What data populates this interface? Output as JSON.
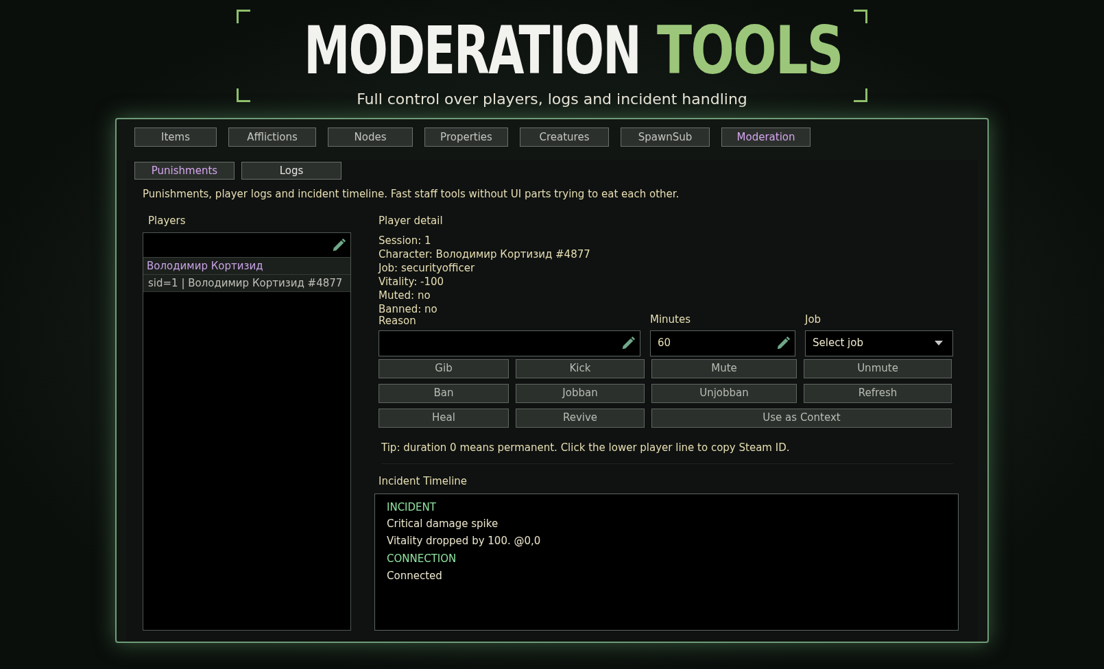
{
  "header": {
    "title_main": "MODERATION",
    "title_accent": "TOOLS",
    "subtitle": "Full control over players, logs and incident handling"
  },
  "tabs": [
    {
      "label": "Items",
      "selected": false
    },
    {
      "label": "Afflictions",
      "selected": false
    },
    {
      "label": "Nodes",
      "selected": false
    },
    {
      "label": "Properties",
      "selected": false
    },
    {
      "label": "Creatures",
      "selected": false
    },
    {
      "label": "SpawnSub",
      "selected": false
    },
    {
      "label": "Moderation",
      "selected": true
    }
  ],
  "subtabs": [
    {
      "label": "Punishments",
      "selected": true
    },
    {
      "label": "Logs",
      "selected": false
    }
  ],
  "description": "Punishments, player logs and incident timeline. Fast staff tools without UI parts trying to eat each other.",
  "players": {
    "label": "Players",
    "entries": [
      {
        "name": "Володимир Кортизид",
        "detail": "sid=1 | Володимир Кортизид #4877"
      }
    ]
  },
  "player_detail": {
    "label": "Player detail",
    "lines": [
      "Session: 1",
      "Character: Володимир Кортизид #4877",
      "Job: securityofficer",
      "Vitality: -100",
      "Muted: no",
      "Banned: no"
    ],
    "reason": {
      "label": "Reason"
    },
    "minutes": {
      "label": "Minutes",
      "value": "60"
    },
    "job": {
      "label": "Job",
      "value": "Select job"
    }
  },
  "actions": [
    {
      "label": "Gib",
      "kind": "normal"
    },
    {
      "label": "Kick",
      "kind": "normal"
    },
    {
      "label": "Mute",
      "kind": "normal"
    },
    {
      "label": "Unmute",
      "kind": "normal"
    },
    {
      "label": "Ban",
      "kind": "normal"
    },
    {
      "label": "Jobban",
      "kind": "normal"
    },
    {
      "label": "Unjobban",
      "kind": "normal"
    },
    {
      "label": "Refresh",
      "kind": "normal"
    },
    {
      "label": "Heal",
      "kind": "normal"
    },
    {
      "label": "Revive",
      "kind": "normal"
    },
    {
      "label": "Use as Context",
      "kind": "wide"
    }
  ],
  "tip": "Tip: duration 0 means permanent. Click the lower player line to copy Steam ID.",
  "timeline": {
    "label": "Incident Timeline",
    "entries": [
      {
        "kind": "heading",
        "text": "INCIDENT"
      },
      {
        "kind": "line",
        "text": "Critical damage spike"
      },
      {
        "kind": "line",
        "text": "Vitality dropped by 100. @0,0"
      },
      {
        "kind": "heading",
        "text": "CONNECTION"
      },
      {
        "kind": "line",
        "text": "Connected"
      }
    ]
  }
}
